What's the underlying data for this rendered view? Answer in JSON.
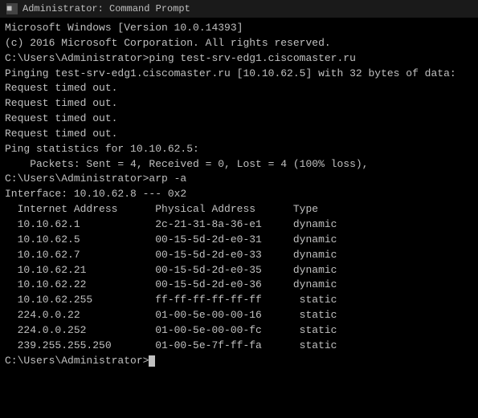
{
  "titleBar": {
    "icon": "cmd-icon",
    "label": "Administrator: Command Prompt"
  },
  "console": {
    "lines": [
      "Microsoft Windows [Version 10.0.14393]",
      "(c) 2016 Microsoft Corporation. All rights reserved.",
      "",
      "C:\\Users\\Administrator>ping test-srv-edg1.ciscomaster.ru",
      "",
      "Pinging test-srv-edg1.ciscomaster.ru [10.10.62.5] with 32 bytes of data:",
      "Request timed out.",
      "Request timed out.",
      "Request timed out.",
      "Request timed out.",
      "",
      "Ping statistics for 10.10.62.5:",
      "    Packets: Sent = 4, Received = 0, Lost = 4 (100% loss),",
      "",
      "C:\\Users\\Administrator>arp -a",
      "",
      "Interface: 10.10.62.8 --- 0x2",
      "  Internet Address      Physical Address      Type",
      "  10.10.62.1            2c-21-31-8a-36-e1     dynamic",
      "  10.10.62.5            00-15-5d-2d-e0-31     dynamic",
      "  10.10.62.7            00-15-5d-2d-e0-33     dynamic",
      "  10.10.62.21           00-15-5d-2d-e0-35     dynamic",
      "  10.10.62.22           00-15-5d-2d-e0-36     dynamic",
      "  10.10.62.255          ff-ff-ff-ff-ff-ff      static",
      "  224.0.0.22            01-00-5e-00-00-16      static",
      "  224.0.0.252           01-00-5e-00-00-fc      static",
      "  239.255.255.250       01-00-5e-7f-ff-fa      static",
      "",
      "C:\\Users\\Administrator>"
    ]
  }
}
